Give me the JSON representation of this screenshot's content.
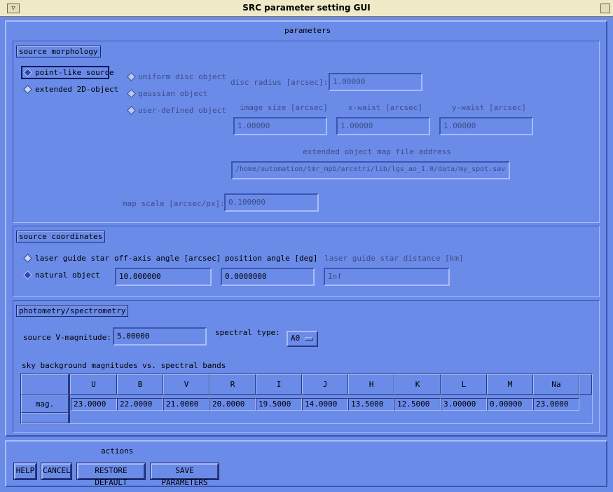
{
  "window": {
    "title": "SRC parameter setting GUI",
    "menu_glyph": "▽"
  },
  "parameters": {
    "label": "parameters",
    "morphology": {
      "section_label": "source morphology",
      "point_like": "point-like source",
      "extended": "extended 2D-object",
      "uniform_disc": "uniform disc object",
      "gaussian": "gaussian object",
      "user_defined": "user-defined object",
      "disc_radius_label": "disc radius [arcsec]:",
      "disc_radius": "1.00000",
      "image_size_label": "image size [arcsec]",
      "image_size": "1.00000",
      "x_waist_label": "x-waist [arcsec]",
      "x_waist": "1.00000",
      "y_waist_label": "y-waist [arcsec]",
      "y_waist": "1.00000",
      "map_file_label": "extended object map file address",
      "map_file": "/home/automation/tmr_mpb/arcetri/lib/lgs_ao_1.0/data/my_spot.sav",
      "map_scale_label": "map scale [arcsec/px]:",
      "map_scale": "0.100000"
    },
    "coordinates": {
      "section_label": "source coordinates",
      "laser_guide_star": "laser guide star",
      "natural_object": "natural object",
      "off_axis_label": "off-axis angle [arcsec]",
      "off_axis": "10.000000",
      "position_angle_label": "position angle [deg]",
      "position_angle": "0.0000000",
      "lgs_distance_label": "laser guide star distance [km]",
      "lgs_distance": "Inf"
    },
    "photometry": {
      "section_label": "photometry/spectrometry",
      "vmag_label": "source V-magnitude:",
      "vmag": "5.00000",
      "spectral_type_label": "spectral type:",
      "spectral_type": "A0",
      "sky_label": "sky background magnitudes vs. spectral bands",
      "row_label": "mag.",
      "bands": [
        "U",
        "B",
        "V",
        "R",
        "I",
        "J",
        "H",
        "K",
        "L",
        "M",
        "Na"
      ],
      "values": [
        "23.0000",
        "22.0000",
        "21.0000",
        "20.0000",
        "19.5000",
        "14.0000",
        "13.5000",
        "12.5000",
        "3.00000",
        "0.00000",
        "23.0000"
      ]
    }
  },
  "actions": {
    "label": "actions",
    "help": "HELP",
    "cancel": "CANCEL",
    "restore": "RESTORE DEFAULT",
    "save": "SAVE PARAMETERS"
  },
  "colors": {
    "background": "#6b8be8",
    "titlebar": "#efe9c8",
    "highlight": "#a9bcf6",
    "shadow": "#3a56b0"
  }
}
